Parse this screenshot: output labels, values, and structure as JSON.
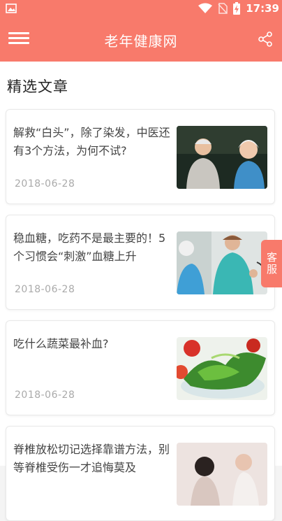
{
  "status_bar": {
    "time": "17:39"
  },
  "app_bar": {
    "title": "老年健康网"
  },
  "section": {
    "title": "精选文章"
  },
  "articles": [
    {
      "title": "解救“白头”，除了染发，中医还有3个方法，为何不试?",
      "date": "2018-06-28"
    },
    {
      "title": "稳血糖，吃药不是最主要的！5个习惯会“刺激”血糖上升",
      "date": "2018-06-28"
    },
    {
      "title": "吃什么蔬菜最补血?",
      "date": "2018-06-28"
    },
    {
      "title": "脊椎放松切记选择靠谱方法，别等脊椎受伤一才追悔莫及",
      "date": ""
    }
  ],
  "service_tab": {
    "label": "客服"
  },
  "colors": {
    "brand": "#f87a6b"
  }
}
